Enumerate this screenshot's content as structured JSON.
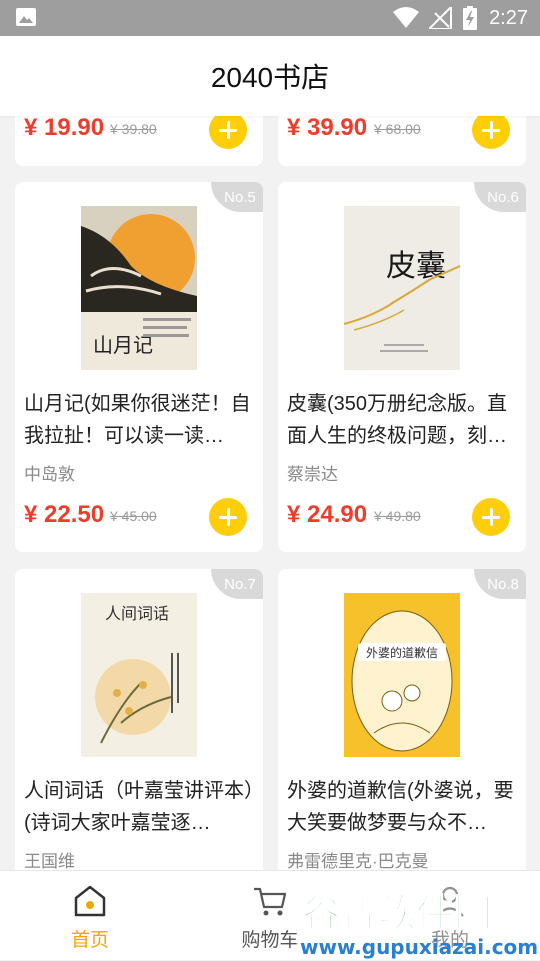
{
  "status": {
    "time": "2:27"
  },
  "appbar": {
    "title": "2040书店"
  },
  "currency": "¥",
  "top_row": [
    {
      "price": "¥ 19.90",
      "original_price": "¥ 39.80"
    },
    {
      "price": "¥ 39.90",
      "original_price": "¥ 68.00"
    }
  ],
  "books": [
    {
      "badge": "No.5",
      "title": "山月记(如果你很迷茫！自我拉扯！可以读一读…",
      "author": "中岛敦",
      "price": "¥ 22.50",
      "original_price": "¥ 45.00",
      "cover_text": "山月记"
    },
    {
      "badge": "No.6",
      "title": "皮囊(350万册纪念版。直面人生的终极问题，刻…",
      "author": "蔡崇达",
      "price": "¥ 24.90",
      "original_price": "¥ 49.80",
      "cover_text": "皮囊"
    },
    {
      "badge": "No.7",
      "title": "人间词话（叶嘉莹讲评本）(诗词大家叶嘉莹逐…",
      "author": "王国维",
      "cover_text": "人间词话"
    },
    {
      "badge": "No.8",
      "title": "外婆的道歉信(外婆说，要大笑要做梦要与众不…",
      "author": "弗雷德里克·巴克曼",
      "cover_text": "外婆的道歉信"
    }
  ],
  "tabs": [
    {
      "label": "首页",
      "active": true
    },
    {
      "label": "购物车",
      "active": false
    },
    {
      "label": "我的",
      "active": false
    }
  ],
  "watermark": {
    "brand": "谷普软件园",
    "url": "www.gupuxiazai.com"
  },
  "colors": {
    "accent": "#f0a800",
    "price": "#f03c2b",
    "add_button": "#ffce0a",
    "statusbar": "#9e9e9e"
  }
}
